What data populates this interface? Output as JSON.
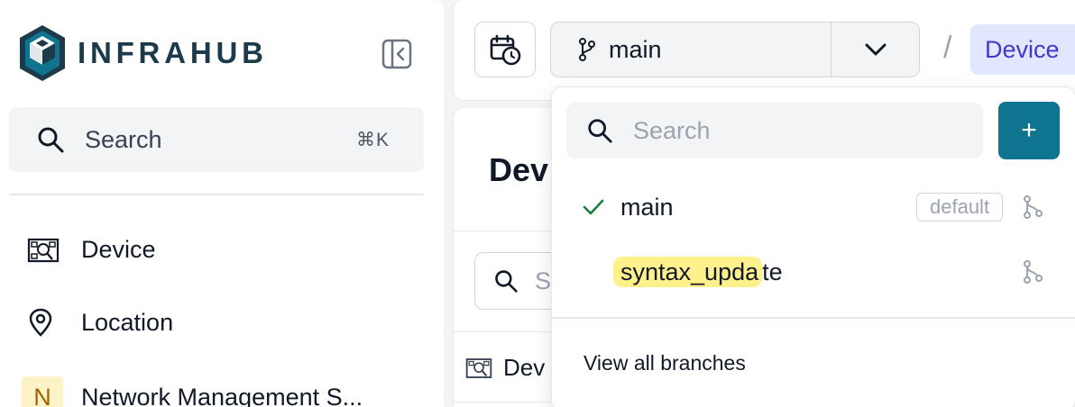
{
  "sidebar": {
    "logo_text": "INFRAHUB",
    "search": {
      "label": "Search",
      "shortcut": "⌘K"
    },
    "nav": [
      {
        "label": "Device",
        "icon": "device-icon"
      },
      {
        "label": "Location",
        "icon": "location-pin-icon"
      },
      {
        "label": "Network Management S...",
        "badge": "N"
      }
    ]
  },
  "header": {
    "branch": "main",
    "breadcrumb_separator": "/",
    "breadcrumb": "Device"
  },
  "content": {
    "title": "Dev",
    "search_placeholder": "S",
    "row_label": "Dev"
  },
  "branch_dropdown": {
    "search_placeholder": "Search",
    "add_label": "+",
    "branches": [
      {
        "name": "main",
        "selected": true,
        "tag": "default"
      },
      {
        "name_highlight": "syntax_upda",
        "name_rest": "te",
        "selected": false
      }
    ],
    "view_all": "View all branches"
  },
  "colors": {
    "accent": "#0e7490",
    "breadcrumb_bg": "#e0e7ff",
    "breadcrumb_text": "#4338ca",
    "highlight": "#fef08a",
    "check": "#15803d"
  }
}
